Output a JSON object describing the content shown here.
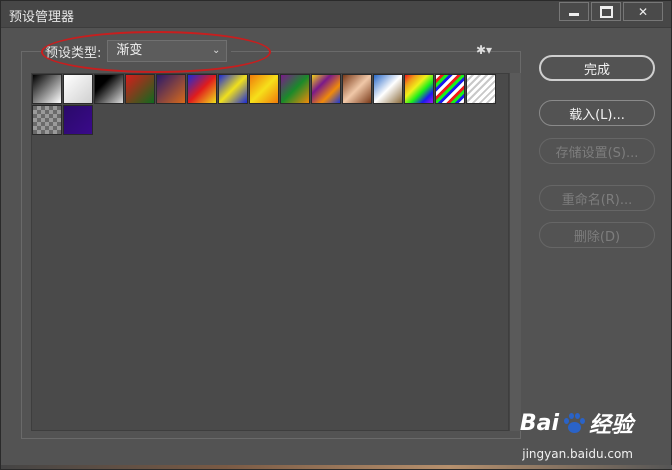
{
  "window": {
    "title": "预设管理器",
    "buttons": [
      "minimize",
      "maximize",
      "close"
    ]
  },
  "toolbar": {
    "preset_type_label": "预设类型:",
    "preset_type_value": "渐变",
    "gear_icon": "gear-icon",
    "chevron_icon": "chevron-down-icon"
  },
  "swatches": [
    {
      "name": "black-white",
      "css": "linear-gradient(135deg,#000,#fff)"
    },
    {
      "name": "white-transparent",
      "css": "linear-gradient(135deg,#fff,#d0d0d0)"
    },
    {
      "name": "black-transparent",
      "css": "linear-gradient(135deg,#000 0%,#000 30%,#ddd 100%)"
    },
    {
      "name": "red-green",
      "css": "linear-gradient(135deg,#d81c1c,#0f6a1e)"
    },
    {
      "name": "violet-orange",
      "css": "linear-gradient(135deg,#2a1a6a,#d86a1a)"
    },
    {
      "name": "blue-red-yellow",
      "css": "linear-gradient(135deg,#1a2ad8,#e01c1c,#f0e01c)"
    },
    {
      "name": "blue-yellow-blue",
      "css": "linear-gradient(135deg,#1a2ad8,#f0e01c,#1a2ad8)"
    },
    {
      "name": "orange-yellow-orange",
      "css": "linear-gradient(135deg,#f07a0a,#f6e01a,#f07a0a)"
    },
    {
      "name": "violet-green-orange",
      "css": "linear-gradient(135deg,#7a1a8a,#1a8a2a,#f08a0a)"
    },
    {
      "name": "yellow-violet-orange-blue",
      "css": "linear-gradient(135deg,#f0d01a,#7a1a8a,#f08a0a,#1a3ad8)"
    },
    {
      "name": "copper",
      "css": "linear-gradient(135deg,#7a3a1a,#f0c8a8,#7a3a1a)"
    },
    {
      "name": "chrome",
      "css": "linear-gradient(135deg,#2a6ac8,#ffffff,#8a6a3a)"
    },
    {
      "name": "spectrum",
      "css": "linear-gradient(135deg,#f01a1a,#f0a01a,#f0f01a,#1af01a,#1a1af0,#a01af0)"
    },
    {
      "name": "transparent-rainbow",
      "css": "repeating-linear-gradient(135deg,#fff 0 3px,#f01a1a 3px 6px,#1af01a 6px 9px,#1a1af0 9px 12px)"
    },
    {
      "name": "transparent-stripes",
      "css": "repeating-linear-gradient(135deg,#fff 0 3px,#c8c8c8 3px 5px)"
    },
    {
      "name": "neutral-density",
      "css": "repeating-conic-gradient(#9a9a9a 0 25%,#6a6a6a 0 50%) 0 0/8px 8px"
    },
    {
      "name": "purple-custom",
      "css": "linear-gradient(135deg,#2a0a6a,#3a0a8a)"
    }
  ],
  "buttons": {
    "done": "完成",
    "load": "载入(L)...",
    "save": "存储设置(S)...",
    "rename": "重命名(R)...",
    "delete": "删除(D)"
  },
  "watermark": {
    "brand_a": "Bai",
    "brand_b": "经验",
    "url": "jingyan.baidu.com"
  }
}
